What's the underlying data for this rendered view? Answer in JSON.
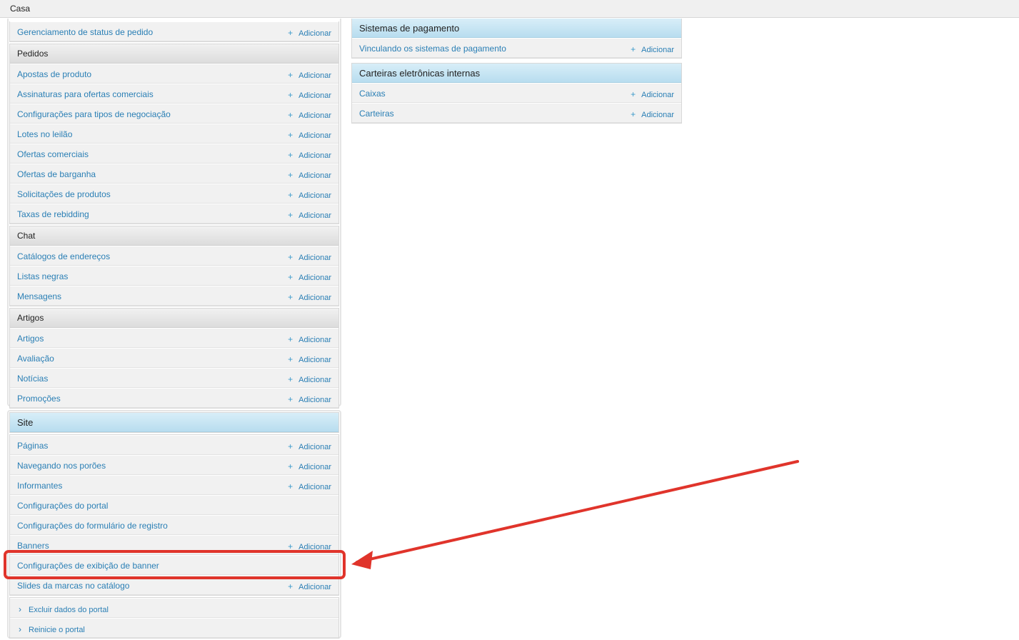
{
  "breadcrumb": "Casa",
  "add_label": "Adicionar",
  "plus_glyph": "+",
  "chevron_glyph": "›",
  "annotation": {
    "color": "#e0342b"
  },
  "left_panel": {
    "top_row": {
      "label": "Gerenciamento de status de pedido",
      "has_add": true
    },
    "sections": [
      {
        "caption": "Pedidos",
        "rows": [
          {
            "label": "Apostas de produto",
            "has_add": true
          },
          {
            "label": "Assinaturas para ofertas comerciais",
            "has_add": true
          },
          {
            "label": "Configurações para tipos de negociação",
            "has_add": true
          },
          {
            "label": "Lotes no leilão",
            "has_add": true
          },
          {
            "label": "Ofertas comerciais",
            "has_add": true
          },
          {
            "label": "Ofertas de barganha",
            "has_add": true
          },
          {
            "label": "Solicitações de produtos",
            "has_add": true
          },
          {
            "label": "Taxas de rebidding",
            "has_add": true
          }
        ]
      },
      {
        "caption": "Chat",
        "rows": [
          {
            "label": "Catálogos de endereços",
            "has_add": true
          },
          {
            "label": "Listas negras",
            "has_add": true
          },
          {
            "label": "Mensagens",
            "has_add": true
          }
        ]
      },
      {
        "caption": "Artigos",
        "rows": [
          {
            "label": "Artigos",
            "has_add": true
          },
          {
            "label": "Avaliação",
            "has_add": true
          },
          {
            "label": "Notícias",
            "has_add": true
          },
          {
            "label": "Promoções",
            "has_add": true
          }
        ]
      }
    ]
  },
  "site_panel": {
    "caption": "Site",
    "rows": [
      {
        "label": "Páginas",
        "has_add": true
      },
      {
        "label": "Navegando nos porões",
        "has_add": true
      },
      {
        "label": "Informantes",
        "has_add": true
      },
      {
        "label": "Configurações do portal",
        "has_add": false
      },
      {
        "label": "Configurações do formulário de registro",
        "has_add": false
      },
      {
        "label": "Banners",
        "has_add": true
      },
      {
        "label": "Configurações de exibição de banner",
        "has_add": false,
        "highlighted": true
      },
      {
        "label": "Slides da marcas no catálogo",
        "has_add": true
      }
    ],
    "actions": [
      {
        "label": "Excluir dados do portal"
      },
      {
        "label": "Reinicie o portal"
      }
    ]
  },
  "right_panel": {
    "sections": [
      {
        "caption": "Sistemas de pagamento",
        "rows": [
          {
            "label": "Vinculando os sistemas de pagamento",
            "has_add": true
          }
        ]
      },
      {
        "caption": "Carteiras eletrônicas internas",
        "rows": [
          {
            "label": "Caixas",
            "has_add": true
          },
          {
            "label": "Carteiras",
            "has_add": true
          }
        ]
      }
    ]
  }
}
